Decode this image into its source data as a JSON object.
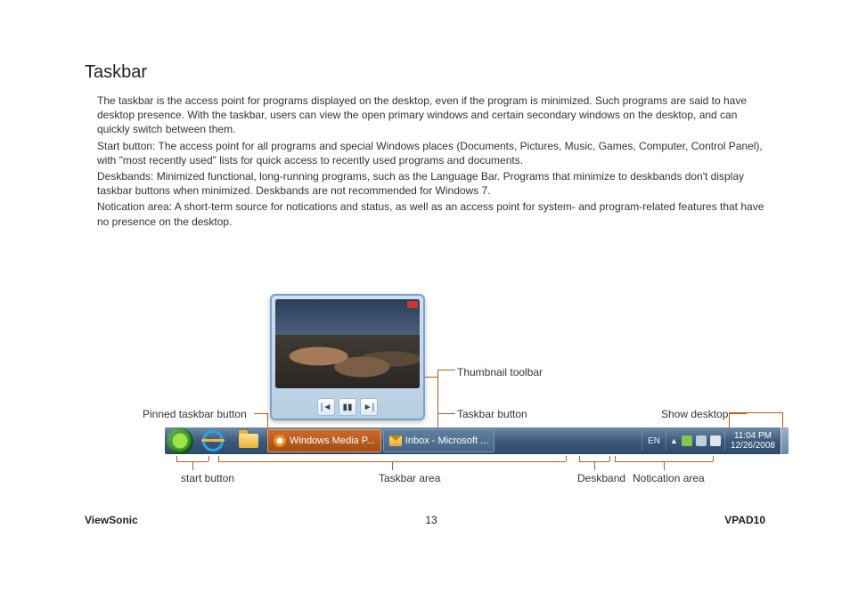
{
  "title": "Taskbar",
  "paragraphs": {
    "p1": "The taskbar is the access point for programs displayed on the desktop, even if the program is minimized. Such programs are said to have desktop presence. With the taskbar, users can view the open primary windows and certain secondary windows on the desktop, and can quickly switch between them.",
    "p2": "Start button: The access point for all programs and special Windows places (Documents, Pictures, Music, Games, Computer, Control Panel), with \"most recently used\" lists for quick access to recently used programs and documents.",
    "p3": "Deskbands: Minimized functional, long-running programs, such as the Language Bar. Programs that minimize to deskbands don't display taskbar buttons when minimized. Deskbands are not recommended for Windows 7.",
    "p4": "Notication area: A short-term source for notications and status, as well as an access point for system- and program-related features that have no presence on the desktop."
  },
  "labels": {
    "pinned": "Pinned taskbar button",
    "start": "start button",
    "taskbar_area": "Taskbar area",
    "thumb_toolbar": "Thumbnail toolbar",
    "taskbar_button": "Taskbar button",
    "deskband": "Deskband",
    "notification": "Notication area",
    "show_desktop": "Show desktop"
  },
  "taskbar": {
    "wmp_label": "Windows Media P...",
    "inbox_label": "Inbox - Microsoft ...",
    "deskband_text": "EN",
    "clock_time": "11:04 PM",
    "clock_date": "12/26/2008"
  },
  "thumb_controls": {
    "prev": "|◄",
    "pause": "▮▮",
    "next": "►|"
  },
  "footer": {
    "brand": "ViewSonic",
    "page": "13",
    "model": "VPAD10"
  }
}
